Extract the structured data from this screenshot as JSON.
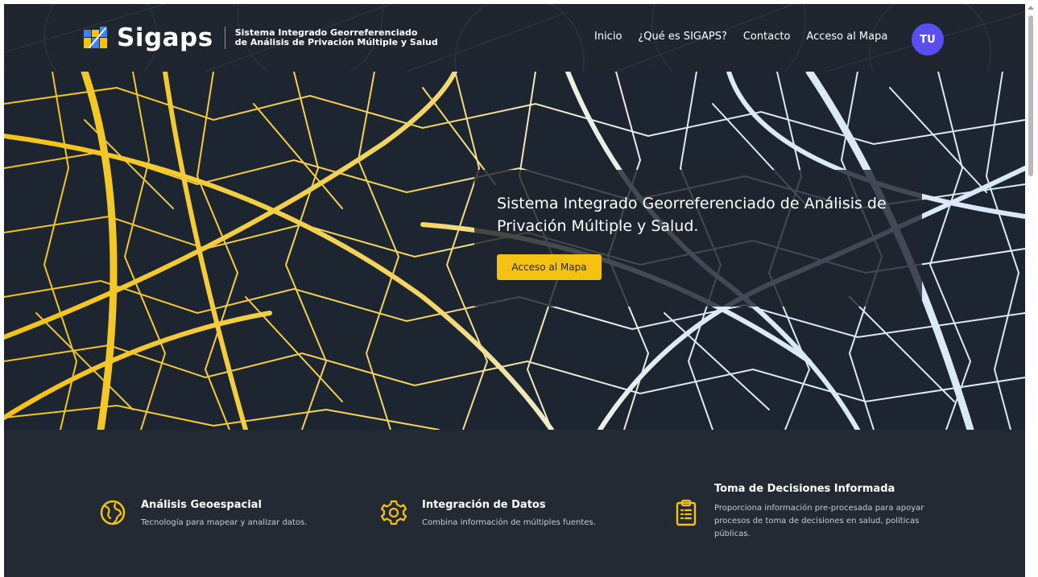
{
  "header": {
    "logo_text": "Sigaps",
    "subtitle_line1": "Sistema Integrado Georreferenciado",
    "subtitle_line2": "de Análisis de Privación Múltiple y Salud",
    "nav": [
      "Inicio",
      "¿Qué es SIGAPS?",
      "Contacto",
      "Acceso al Mapa"
    ],
    "avatar_initials": "TU"
  },
  "hero": {
    "title": "Sistema Integrado Georreferenciado de Análisis de Privación Múltiple y Salud.",
    "button_label": "Acceso al Mapa"
  },
  "features": [
    {
      "icon": "globe-icon",
      "title": "Análisis Geoespacial",
      "description": "Tecnología para mapear y analizar datos."
    },
    {
      "icon": "gear-icon",
      "title": "Integración de Datos",
      "description": "Combina información de múltiples fuentes."
    },
    {
      "icon": "clipboard-icon",
      "title": "Toma de Decisiones Informada",
      "description": "Proporciona información pre-procesada para apoyar procesos de toma de decisiones en salud, políticas públicas."
    }
  ],
  "colors": {
    "accent": "#f5c214",
    "avatar": "#5b4ef0",
    "background": "#232a34"
  }
}
